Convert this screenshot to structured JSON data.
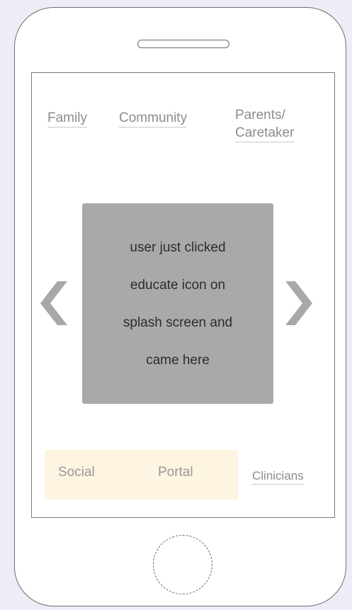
{
  "nav": {
    "family": "Family",
    "community": "Community",
    "parents_caretaker": "Parents/\nCaretaker"
  },
  "carousel": {
    "lines": [
      "user just clicked",
      "educate icon on",
      "splash screen and",
      "came here"
    ],
    "prev_icon": "chevron-left-icon",
    "next_icon": "chevron-right-icon"
  },
  "bottom": {
    "social": "Social",
    "portal": "Portal",
    "clinicians": "Clinicians"
  },
  "colors": {
    "background": "#ecedf6",
    "carousel_bg": "#a9a9a9",
    "bottom_bar_bg": "#fdf4e2",
    "link_text": "#8c8c8c"
  }
}
